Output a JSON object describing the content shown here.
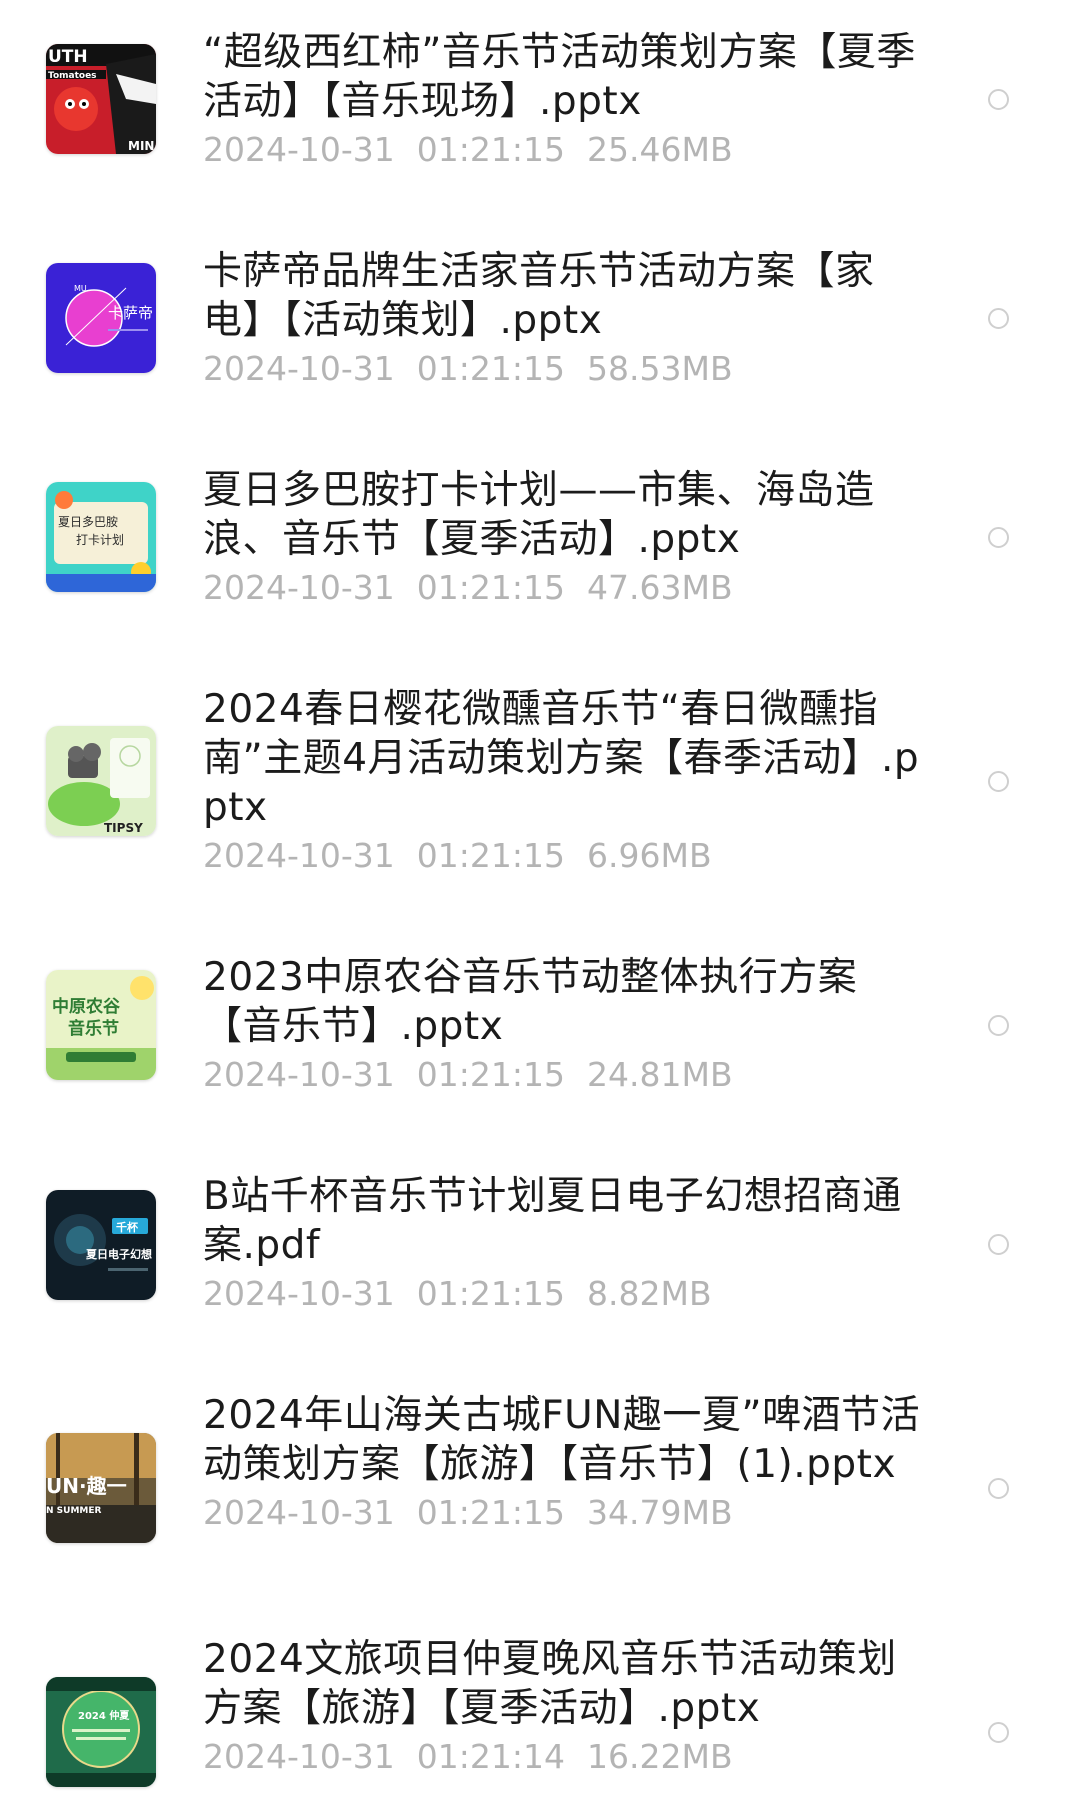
{
  "files": [
    {
      "name": "“超级西红柿”音乐节活动策划方案【夏季活动】【音乐现场】.pptx",
      "date": "2024-10-31",
      "time": "01:21:15",
      "size": "25.46MB",
      "thumb_icon": "tomato-festival-thumbnail"
    },
    {
      "name": "卡萨帝品牌生活家音乐节活动方案【家电】【活动策划】.pptx",
      "date": "2024-10-31",
      "time": "01:21:15",
      "size": "58.53MB",
      "thumb_icon": "casarte-thumbnail"
    },
    {
      "name": "夏日多巴胺打卡计划——市集、海岛造浪、音乐节【夏季活动】.pptx",
      "date": "2024-10-31",
      "time": "01:21:15",
      "size": "47.63MB",
      "thumb_icon": "summer-dopamine-thumbnail"
    },
    {
      "name": "2024春日樱花微醺音乐节“春日微醺指南”主题4月活动策划方案【春季活动】.pptx",
      "date": "2024-10-31",
      "time": "01:21:15",
      "size": "6.96MB",
      "thumb_icon": "spring-tipsy-thumbnail"
    },
    {
      "name": "2023中原农谷音乐节动整体执行方案【音乐节】.pptx",
      "date": "2024-10-31",
      "time": "01:21:15",
      "size": "24.81MB",
      "thumb_icon": "zhongyuan-music-thumbnail"
    },
    {
      "name": "B站千杯音乐节计划夏日电子幻想招商通案.pdf",
      "date": "2024-10-31",
      "time": "01:21:15",
      "size": "8.82MB",
      "thumb_icon": "bilibili-festival-thumbnail"
    },
    {
      "name": "2024年山海关古城FUN趣一夏”啤酒节活动策划方案【旅游】【音乐节】(1).pptx",
      "date": "2024-10-31",
      "time": "01:21:15",
      "size": "34.79MB",
      "thumb_icon": "fun-summer-thumbnail"
    },
    {
      "name": "2024文旅项目仲夏晚风音乐节活动策划方案【旅游】【夏季活动】.pptx",
      "date": "2024-10-31",
      "time": "01:21:14",
      "size": "16.22MB",
      "thumb_icon": "midsummer-breeze-thumbnail"
    }
  ],
  "thumb_text": {
    "t1_top": "UTH",
    "t1_brand": "Tomatoes",
    "t1_corner": "MIN",
    "t2_brand": "卡萨帝",
    "t2_small": "MU",
    "t3_line1": "夏日多巴胺",
    "t3_line2": "打卡计划",
    "t4_label": "TIPSY",
    "t5_line1": "中原农谷",
    "t5_line2": "音乐节",
    "t6_tag": "千杯",
    "t6_title": "夏日电子幻想",
    "t7_title": "UN·趣一",
    "t7_sub": "N SUMMER",
    "t8_year": "2024 仲夏"
  }
}
